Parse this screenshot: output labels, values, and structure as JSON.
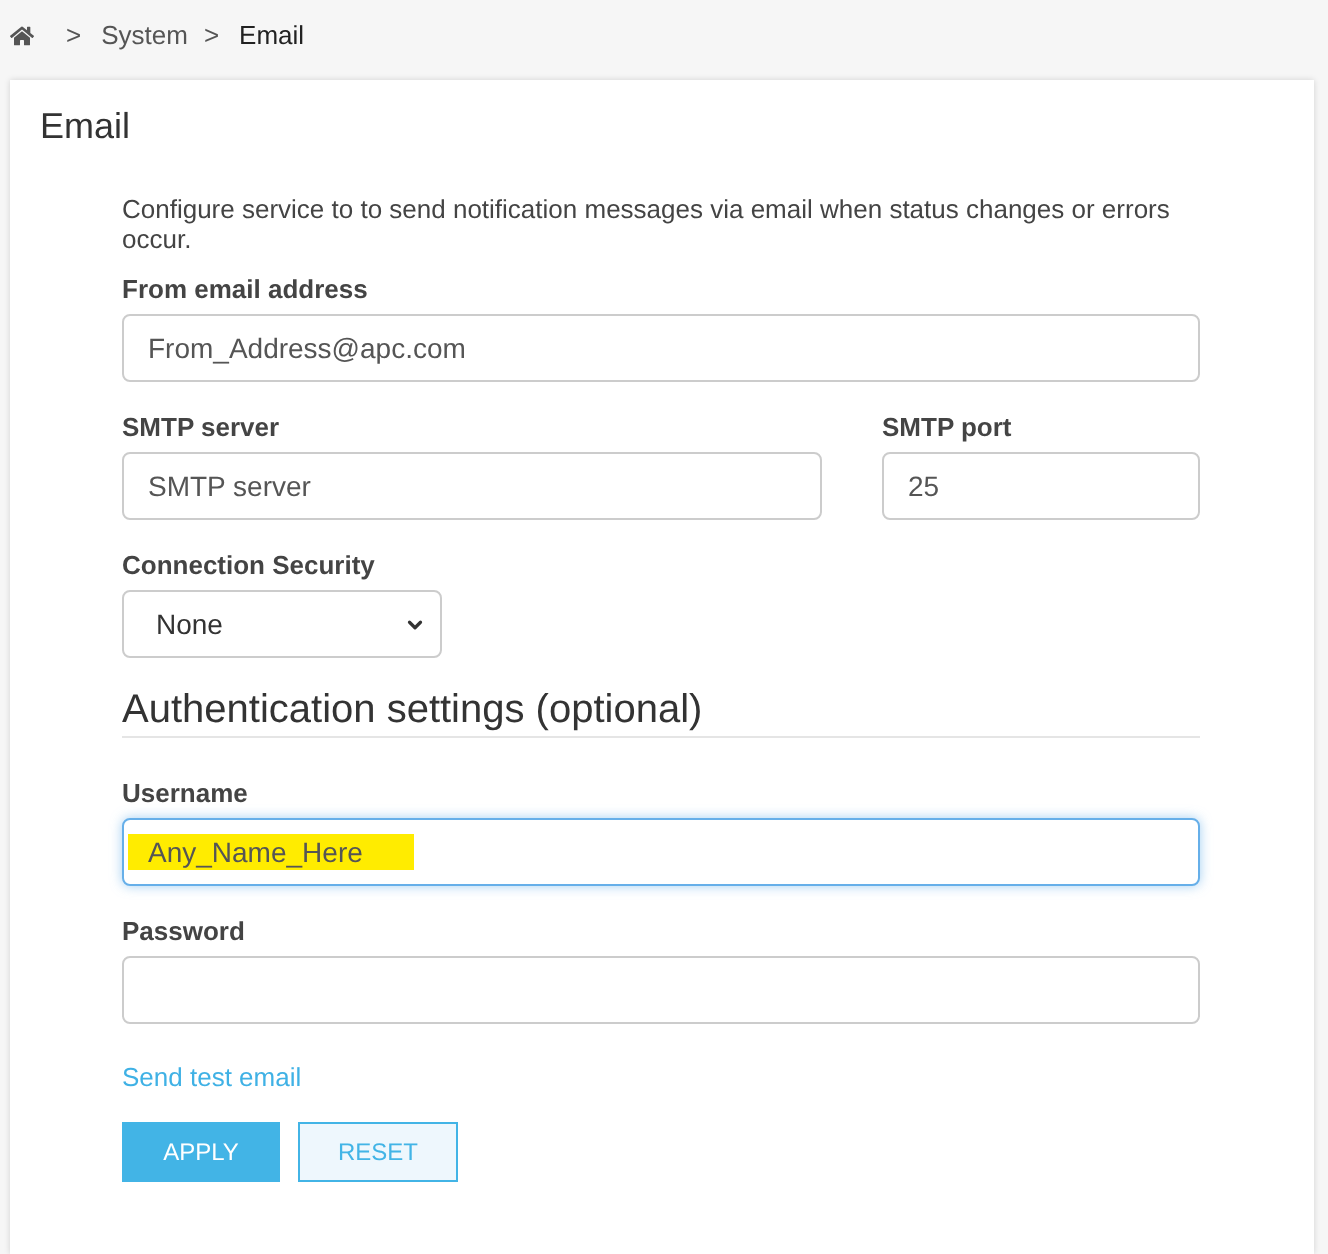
{
  "breadcrumb": [
    {
      "kind": "home"
    },
    {
      "kind": "link",
      "separator": ">",
      "label": "System"
    },
    {
      "kind": "current",
      "separator": ">",
      "label": "Email"
    }
  ],
  "card": {
    "title": "Email"
  },
  "form": {
    "description": "Configure service to to send notification messages via email when status changes or errors occur.",
    "rows": [
      [
        {
          "kind": "text",
          "label": "From email address",
          "value": "From_Address@apc.com",
          "focused": false,
          "highlighted": false
        }
      ],
      [
        {
          "kind": "text",
          "label": "SMTP server",
          "value": "SMTP server",
          "focused": false,
          "highlighted": false
        },
        {
          "kind": "text",
          "label": "SMTP port",
          "value": "25",
          "focused": false,
          "highlighted": false
        }
      ],
      [
        {
          "kind": "select",
          "label": "Connection Security",
          "value": "None",
          "focused": false,
          "highlighted": false
        }
      ]
    ]
  },
  "authentication": {
    "heading": "Authentication settings (optional)",
    "fields": [
      {
        "kind": "text",
        "label": "Username",
        "value": "Any_Name_Here",
        "focused": true,
        "highlighted": true
      },
      {
        "kind": "password",
        "label": "Password",
        "focused": false,
        "highlighted": false
      }
    ]
  },
  "test_link": "Send test email",
  "buttons": [
    {
      "label": "APPLY",
      "kind": "primary"
    },
    {
      "label": "RESET",
      "kind": "secondary"
    }
  ]
}
